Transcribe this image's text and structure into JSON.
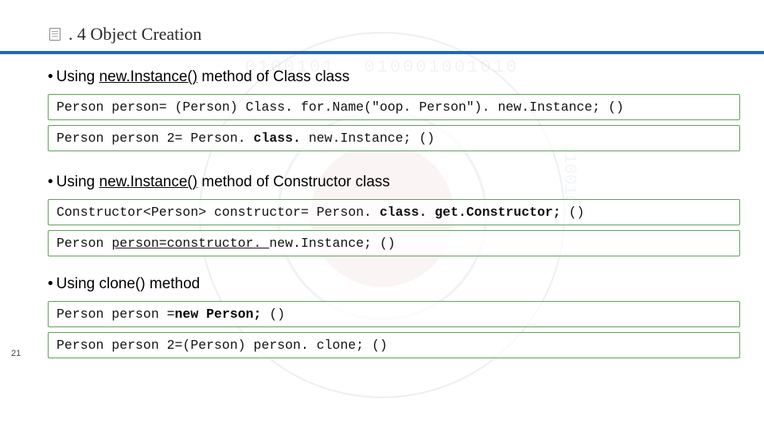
{
  "slide": {
    "number": "21",
    "title_prefix": ". 4",
    "title_main": "Object Creation"
  },
  "sections": [
    {
      "id": "class-newinstance",
      "heading_pre": "Using ",
      "heading_underlined": "new.Instance()",
      "heading_post": " method of Class class",
      "codes": [
        {
          "segments": [
            {
              "text": "Person person= (Person) Class. for.Name(\"oop. Person\"). new.Instance; ()"
            }
          ]
        },
        {
          "segments": [
            {
              "text": "Person person 2= Person. "
            },
            {
              "text": "class. ",
              "cls": "kw"
            },
            {
              "text": "new.Instance; ()"
            }
          ]
        }
      ]
    },
    {
      "id": "constructor-newinstance",
      "heading_pre": "Using ",
      "heading_underlined": "new.Instance()",
      "heading_post": " method of Constructor class",
      "codes": [
        {
          "segments": [
            {
              "text": "Constructor<Person> constructor= Person. "
            },
            {
              "text": "class. get.Constructor; ",
              "cls": "kw"
            },
            {
              "text": "()"
            }
          ]
        },
        {
          "segments": [
            {
              "text": "Person "
            },
            {
              "text": "person=constructor. ",
              "cls": "ul"
            },
            {
              "text": "new.Instance; ()"
            }
          ]
        }
      ]
    },
    {
      "id": "clone",
      "heading_pre": "Using clone() method",
      "heading_underlined": "",
      "heading_post": "",
      "codes": [
        {
          "segments": [
            {
              "text": "Person person ="
            },
            {
              "text": "new Person; ",
              "cls": "new"
            },
            {
              "text": "()"
            }
          ]
        },
        {
          "segments": [
            {
              "text": "Person person 2=(Person) person. clone; ()"
            }
          ]
        }
      ]
    }
  ]
}
